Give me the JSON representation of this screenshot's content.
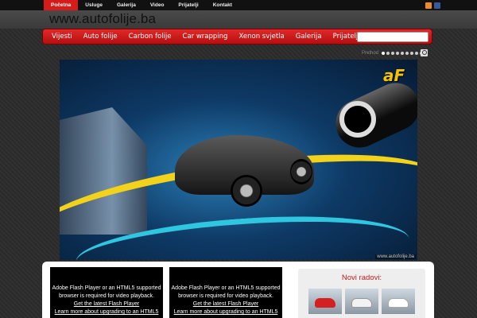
{
  "topnav": [
    "Početna",
    "Usluge",
    "Galerija",
    "Video",
    "Prijatelji",
    "Kontakt"
  ],
  "social": {
    "rss": "rss-icon",
    "facebook": "facebook-icon"
  },
  "site_title": "www.autofolije.ba",
  "mainnav": [
    "Vijesti",
    "Auto folije",
    "Carbon folije",
    "Car wrapping",
    "Xenon svjetla",
    "Galerija",
    "Prijatelji"
  ],
  "search": {
    "placeholder": ""
  },
  "slider": {
    "prev_label": "Prethod",
    "dots": 9,
    "active_dot": 0
  },
  "hero": {
    "watermark": "www.autofolije.ba",
    "logo_text": "aF"
  },
  "videos": [
    {
      "line1": "Adobe Flash Player or an HTML5 supported",
      "line2": "browser is required for video playback.",
      "link1": "Get the latest Flash Player",
      "link2": "Learn more about upgrading to an HTML5"
    },
    {
      "line1": "Adobe Flash Player or an HTML5 supported",
      "line2": "browser is required for video playback.",
      "link1": "Get the latest Flash Player",
      "link2": "Learn more about upgrading to an HTML5"
    }
  ],
  "news": {
    "title": "Novi radovi:"
  },
  "colors": {
    "accent": "#d61b1b",
    "background": "#2e2e2e"
  }
}
